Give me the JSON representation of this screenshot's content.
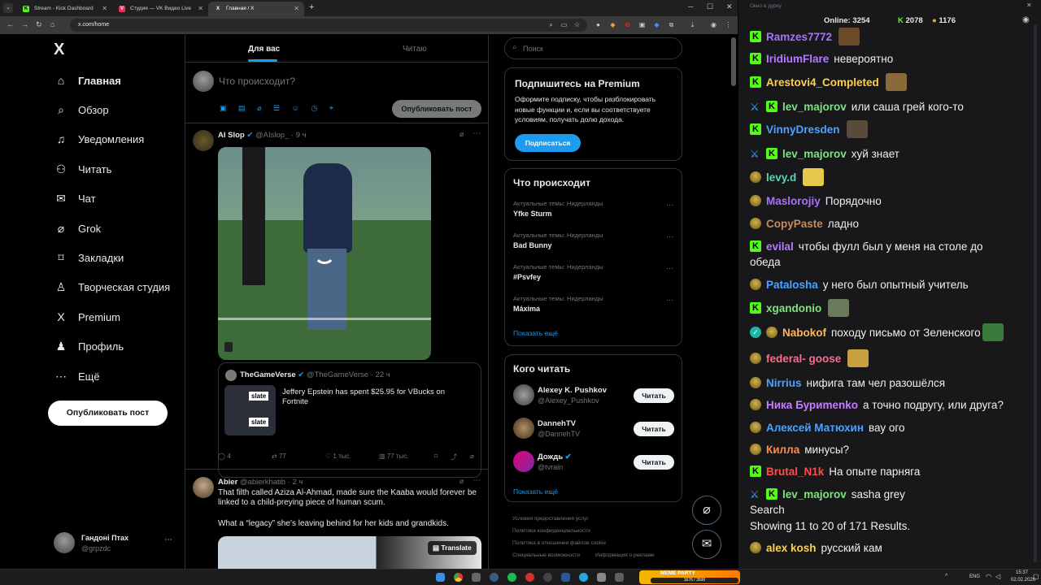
{
  "browser": {
    "tabs": [
      {
        "title": "Stream - Kick Dashboard",
        "icon": "kick-icon",
        "active": false
      },
      {
        "title": "Студия — VK Видео Live",
        "icon": "vk-icon",
        "active": false
      },
      {
        "title": "Главная / X",
        "icon": "x-icon",
        "active": true
      }
    ],
    "url": "x.com/home",
    "new_tab": "+"
  },
  "x_nav": {
    "logo": "X",
    "items": [
      {
        "label": "Главная",
        "icon": "home-icon",
        "glyph": "⌂",
        "bold": true
      },
      {
        "label": "Обзор",
        "icon": "search-icon",
        "glyph": "⌕",
        "bold": false
      },
      {
        "label": "Уведомления",
        "icon": "bell-icon",
        "glyph": "♫",
        "bold": false
      },
      {
        "label": "Читать",
        "icon": "follow-icon",
        "glyph": "⚇",
        "bold": false
      },
      {
        "label": "Чат",
        "icon": "mail-icon",
        "glyph": "✉",
        "bold": false
      },
      {
        "label": "Grok",
        "icon": "grok-icon",
        "glyph": "⌀",
        "bold": false
      },
      {
        "label": "Закладки",
        "icon": "bookmark-icon",
        "glyph": "⌑",
        "bold": false
      },
      {
        "label": "Творческая студия",
        "icon": "studio-icon",
        "glyph": "♙",
        "bold": false
      },
      {
        "label": "Premium",
        "icon": "x-premium-icon",
        "glyph": "X",
        "bold": false
      },
      {
        "label": "Профиль",
        "icon": "profile-icon",
        "glyph": "♟",
        "bold": false
      },
      {
        "label": "Ещё",
        "icon": "more-icon",
        "glyph": "⋯",
        "bold": false
      }
    ],
    "post_button": "Опубликовать пост",
    "account": {
      "name": "Гандоні Птах",
      "handle": "@grpzdc",
      "more": "⋯"
    }
  },
  "feed": {
    "tabs": [
      "Для вас",
      "Читаю"
    ],
    "compose_placeholder": "Что происходит?",
    "compose_button": "Опубликовать пост",
    "tweet1": {
      "name": "AI Slop",
      "handle": "@AIslop_",
      "time": "· 9 ч",
      "quote": {
        "name": "TheGameVerse",
        "handle": "@TheGameVerse",
        "time": "· 22 ч",
        "text": "Jeffery Epstein has spent $25.95 for VBucks on Fortnite",
        "thumb_label": "slate"
      },
      "replies": "4",
      "retweets": "77",
      "likes": "1 тыс.",
      "views": "77 тыс."
    },
    "tweet2": {
      "name": "Abier",
      "handle": "@abierkhatib",
      "time": "· 2 ч",
      "text1": "That filth called Aziza Al-Ahmad, made sure the Kaaba would forever be linked to a child-preying piece of human scum.",
      "text2": "What a “legacy” she’s leaving behind for her kids and grandkids.",
      "translate": "Translate"
    }
  },
  "right": {
    "search_placeholder": "Поиск",
    "premium": {
      "title": "Подпишитесь на Premium",
      "body": "Оформите подписку, чтобы разблокировать новые функции и, если вы соответствуете условиям, получать долю дохода.",
      "button": "Подписаться"
    },
    "trends": {
      "title": "Что происходит",
      "items": [
        {
          "category": "Актуальные темы: Нидерланды",
          "name": "Yfke Sturm"
        },
        {
          "category": "Актуальные темы: Нидерланды",
          "name": "Bad Bunny"
        },
        {
          "category": "Актуальные темы: Нидерланды",
          "name": "#Psvfey"
        },
        {
          "category": "Актуальные темы: Нидерланды",
          "name": "Máxima"
        }
      ],
      "show_more": "Показать ещё"
    },
    "who_to_follow": {
      "title": "Кого читать",
      "items": [
        {
          "name": "Alexey K. Pushkov",
          "handle": "@Alexey_Pushkov",
          "button": "Читать",
          "verified": false
        },
        {
          "name": "DannehTV",
          "handle": "@DannehTV",
          "button": "Читать",
          "verified": false
        },
        {
          "name": "Дождь",
          "handle": "@tvrain",
          "button": "Читать",
          "verified": true
        }
      ],
      "show_more": "Показать ещё"
    },
    "footer": [
      "Условия предоставления услуг",
      "Политика конфиденциальности",
      "Политика в отношении файлов cookie",
      "Специальные возможности",
      "Информация о рекламе"
    ]
  },
  "chat": {
    "window_title": "Окно в дурку",
    "online_label": "Online:",
    "online": "3254",
    "kick_count": "2078",
    "other_count": "1176",
    "messages": [
      {
        "badges": [
          "kick"
        ],
        "nick": "Ramzes7772",
        "color": "#a970ff",
        "text": "",
        "emote": true
      },
      {
        "badges": [
          "kick"
        ],
        "nick": "IridiumFlare",
        "color": "#b57bff",
        "text": "невероятно",
        "emote": false
      },
      {
        "badges": [
          "kick"
        ],
        "nick": "Arestovi4_Completed",
        "color": "#ffd04d",
        "text": "",
        "emote": true
      },
      {
        "badges": [
          "sword",
          "kick"
        ],
        "nick": "lev_majorov",
        "color": "#7ee37e",
        "text": "или саша грей кого-то",
        "emote": false
      },
      {
        "badges": [
          "kick"
        ],
        "nick": "VinnyDresden",
        "color": "#4aa3ff",
        "text": "",
        "emote": true
      },
      {
        "badges": [
          "sword",
          "kick"
        ],
        "nick": "lev_majorov",
        "color": "#7ee37e",
        "text": "хуй знает",
        "emote": false
      },
      {
        "badges": [
          "pepe"
        ],
        "nick": "levy.d",
        "color": "#56d6b5",
        "text": "",
        "emote": true
      },
      {
        "badges": [
          "pepe"
        ],
        "nick": "Maslorojiy",
        "color": "#a970ff",
        "text": "Порядочно",
        "emote": false
      },
      {
        "badges": [
          "pepe"
        ],
        "nick": "CopyPaste",
        "color": "#c98a5a",
        "text": "ладно",
        "emote": false
      },
      {
        "badges": [
          "kick"
        ],
        "nick": "evilal",
        "color": "#b57bff",
        "text": "чтобы фулл был у меня на столе до",
        "text2": "обеда",
        "emote": false
      },
      {
        "badges": [
          "pepe"
        ],
        "nick": "Patalosha",
        "color": "#4aa3ff",
        "text": "у него был опытный учитель",
        "emote": false
      },
      {
        "badges": [
          "kick"
        ],
        "nick": "xgandonio",
        "color": "#7ee37e",
        "text": "",
        "emote": true
      },
      {
        "badges": [
          "verified",
          "pepe"
        ],
        "nick": "Nabokof",
        "color": "#ffb84d",
        "text": "походу письмо от Зеленского",
        "emote": true
      },
      {
        "badges": [
          "pepe"
        ],
        "nick": "federal- goose",
        "color": "#ff6b8a",
        "text": "",
        "emote": true
      },
      {
        "badges": [
          "pepe"
        ],
        "nick": "Nirrius",
        "color": "#4aa3ff",
        "text": "нифига там чел разошёлся",
        "emote": false
      },
      {
        "badges": [
          "pepe"
        ],
        "nick": "Ника Буриmenko",
        "color": "#c77dff",
        "text": "а точно подругу, или друга?",
        "emote": false
      },
      {
        "badges": [
          "pepe"
        ],
        "nick": "Алексей Матюхин",
        "color": "#4aa3ff",
        "text": "вау ого",
        "emote": false
      },
      {
        "badges": [
          "pepe"
        ],
        "nick": "Килла",
        "color": "#ff8c42",
        "text": "минусы?",
        "emote": false
      },
      {
        "badges": [
          "kick"
        ],
        "nick": "Brutal_N1k",
        "color": "#ff4d4d",
        "text": "На опыте парняга",
        "emote": false
      },
      {
        "badges": [
          "sword",
          "kick"
        ],
        "nick": "lev_majorov",
        "color": "#7ee37e",
        "text": "sasha grey",
        "text2": "Search",
        "text3": "Showing 11 to 20 of 171 Results.",
        "emote": false
      },
      {
        "badges": [
          "pepe"
        ],
        "nick": "alex kosh",
        "color": "#ffd04d",
        "text": "русский кам",
        "emote": false
      }
    ]
  },
  "taskbar": {
    "lang": "ENG",
    "time": "15:37",
    "date": "02.02.2026",
    "widget": "MEME PARTY",
    "widget_sub": "1676 / 3500"
  }
}
